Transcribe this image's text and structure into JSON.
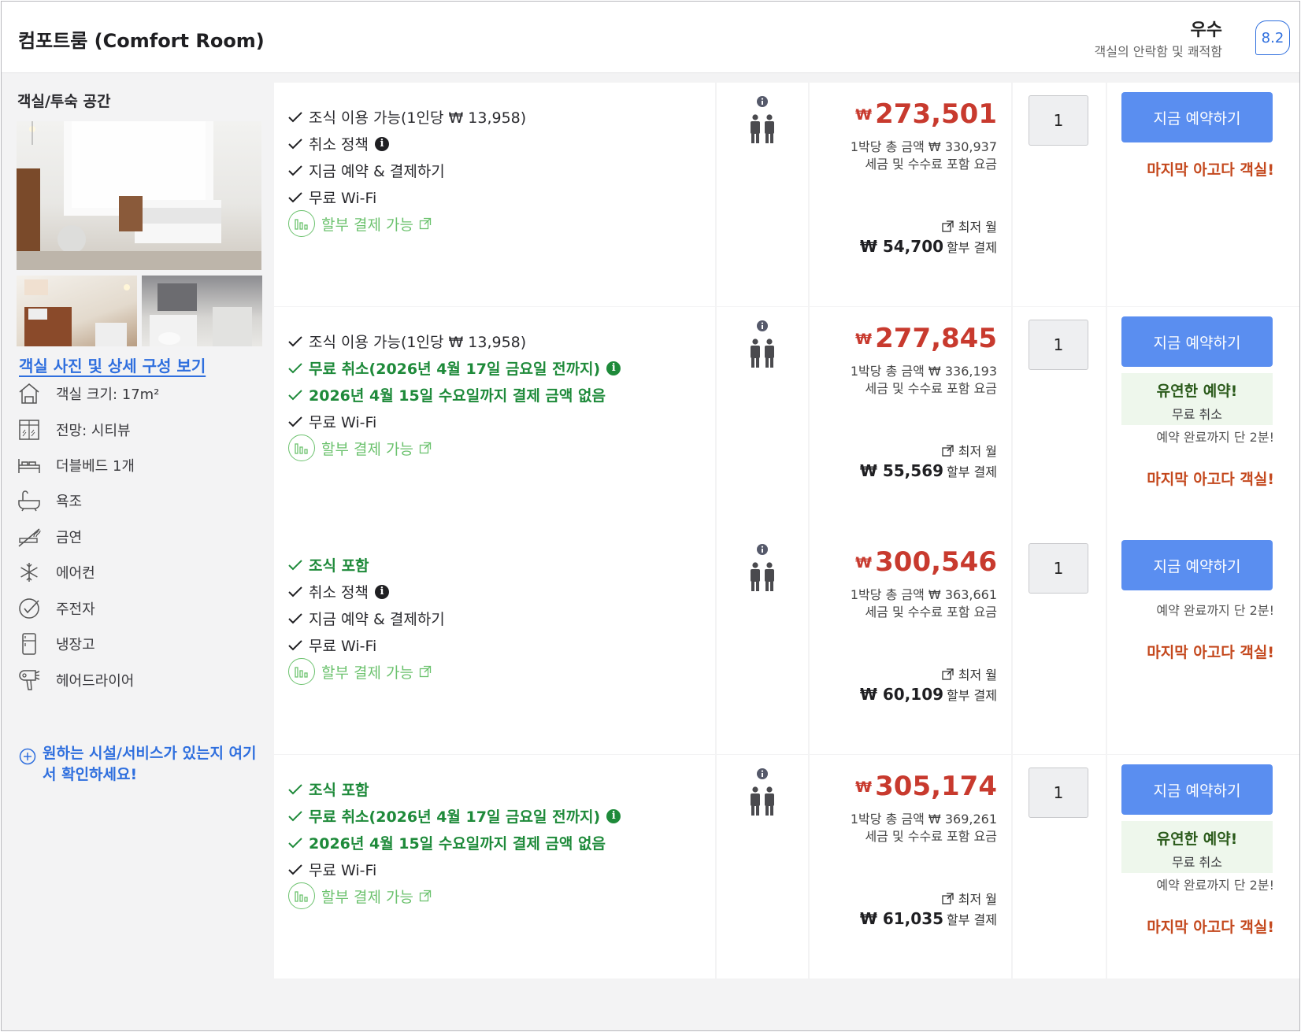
{
  "header": {
    "room_title": "컴포트룸 (Comfort Room)",
    "rating_word": "우수",
    "rating_sub": "객실의 안락함 및 쾌적함",
    "score": "8.2"
  },
  "left": {
    "space_title": "객실/투숙 공간",
    "see_photos": "객실 사진 및 상세 구성 보기",
    "amenities": [
      {
        "icon": "house-icon",
        "label": "객실 크기: 17m²"
      },
      {
        "icon": "window-view-icon",
        "label": "전망: 시티뷰"
      },
      {
        "icon": "bed-icon",
        "label": "더블베드 1개"
      },
      {
        "icon": "bathtub-icon",
        "label": "욕조"
      },
      {
        "icon": "no-smoking-icon",
        "label": "금연"
      },
      {
        "icon": "snowflake-icon",
        "label": "에어컨"
      },
      {
        "icon": "kettle-icon",
        "label": "주전자"
      },
      {
        "icon": "fridge-icon",
        "label": "냉장고"
      },
      {
        "icon": "hair-dryer-icon",
        "label": "헤어드라이어"
      }
    ],
    "ask_link": "원하는 시설/서비스가 있는지 여기서 확인하세요!"
  },
  "common": {
    "installment": "할부 결제 가능",
    "price_currency": "₩",
    "total_prefix": "1박당 총 금액 ₩",
    "tax_note": "세금 및 수수료 포함 요금",
    "monthly_label": "최저 월",
    "monthly_suffix": "할부 결제",
    "book_label": "지금 예약하기",
    "flex_title": "유연한 예약!",
    "flex_sub": "무료 취소",
    "countdown": "예약 완료까지 단 2분!",
    "last_room": "마지막 아고다 객실!",
    "info_glyph": "i"
  },
  "offers": [
    {
      "features": [
        {
          "text": "조식 이용 가능(1인당 ₩ 13,958)",
          "green": false,
          "info": false
        },
        {
          "text": "취소 정책",
          "green": false,
          "info": true
        },
        {
          "text": "지금 예약 & 결제하기",
          "green": false,
          "info": false
        },
        {
          "text": "무료 Wi-Fi",
          "green": false,
          "info": false
        }
      ],
      "price": "273,501",
      "total": "330,937",
      "monthly": "₩ 54,700",
      "qty": "1",
      "flex": false,
      "countdown": false
    },
    {
      "features": [
        {
          "text": "조식 이용 가능(1인당 ₩ 13,958)",
          "green": false,
          "info": false
        },
        {
          "text": "무료 취소(2026년 4월 17일 금요일 전까지)",
          "green": true,
          "info": true
        },
        {
          "text": "2026년 4월 15일 수요일까지 결제 금액 없음",
          "green": true,
          "info": false
        },
        {
          "text": "무료 Wi-Fi",
          "green": false,
          "info": false
        }
      ],
      "price": "277,845",
      "total": "336,193",
      "monthly": "₩ 55,569",
      "qty": "1",
      "flex": true,
      "countdown": true
    },
    {
      "features": [
        {
          "text": "조식 포함",
          "green": true,
          "info": false
        },
        {
          "text": "취소 정책",
          "green": false,
          "info": true
        },
        {
          "text": "지금 예약 & 결제하기",
          "green": false,
          "info": false
        },
        {
          "text": "무료 Wi-Fi",
          "green": false,
          "info": false
        }
      ],
      "price": "300,546",
      "total": "363,661",
      "monthly": "₩ 60,109",
      "qty": "1",
      "flex": false,
      "countdown": true
    },
    {
      "features": [
        {
          "text": "조식 포함",
          "green": true,
          "info": false
        },
        {
          "text": "무료 취소(2026년 4월 17일 금요일 전까지)",
          "green": true,
          "info": true
        },
        {
          "text": "2026년 4월 15일 수요일까지 결제 금액 없음",
          "green": true,
          "info": false
        },
        {
          "text": "무료 Wi-Fi",
          "green": false,
          "info": false
        }
      ],
      "price": "305,174",
      "total": "369,261",
      "monthly": "₩ 61,035",
      "qty": "1",
      "flex": true,
      "countdown": true
    }
  ]
}
